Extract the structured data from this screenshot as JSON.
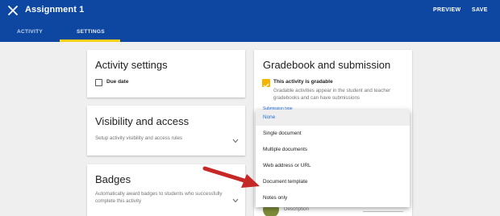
{
  "appbar": {
    "title": "Assignment 1",
    "preview_label": "PREVIEW",
    "save_label": "SAVE",
    "tabs": [
      {
        "label": "ACTIVITY",
        "active": false
      },
      {
        "label": "SETTINGS",
        "active": true
      }
    ],
    "brand_color": "#0d47a1",
    "accent_color": "#fcd116"
  },
  "activity_settings": {
    "title": "Activity settings",
    "due_date_label": "Due date",
    "due_date_checked": false
  },
  "visibility": {
    "title": "Visibility and access",
    "description": "Setup activity visibility and access rules"
  },
  "badges": {
    "title": "Badges",
    "description_line1": "Automatically award badges to students who successfully",
    "description_line2": "complete this activity"
  },
  "gradebook": {
    "title": "Gradebook and submission",
    "gradable_label": "This activity is gradable",
    "gradable_checked": true,
    "desc_line1": "Gradable activities appear in the student and teacher",
    "desc_line2": "gradebooks and can have submissions",
    "submission_type_label": "Submission type",
    "partial_label": "Description"
  },
  "submission_menu": {
    "options": [
      "None",
      "Single document",
      "Multiple documents",
      "Web address or URL",
      "Document template",
      "Notes only"
    ],
    "selected": "None"
  },
  "icons": [
    "close-icon",
    "chevron-down-icon",
    "check-icon",
    "red-arrow-icon"
  ]
}
